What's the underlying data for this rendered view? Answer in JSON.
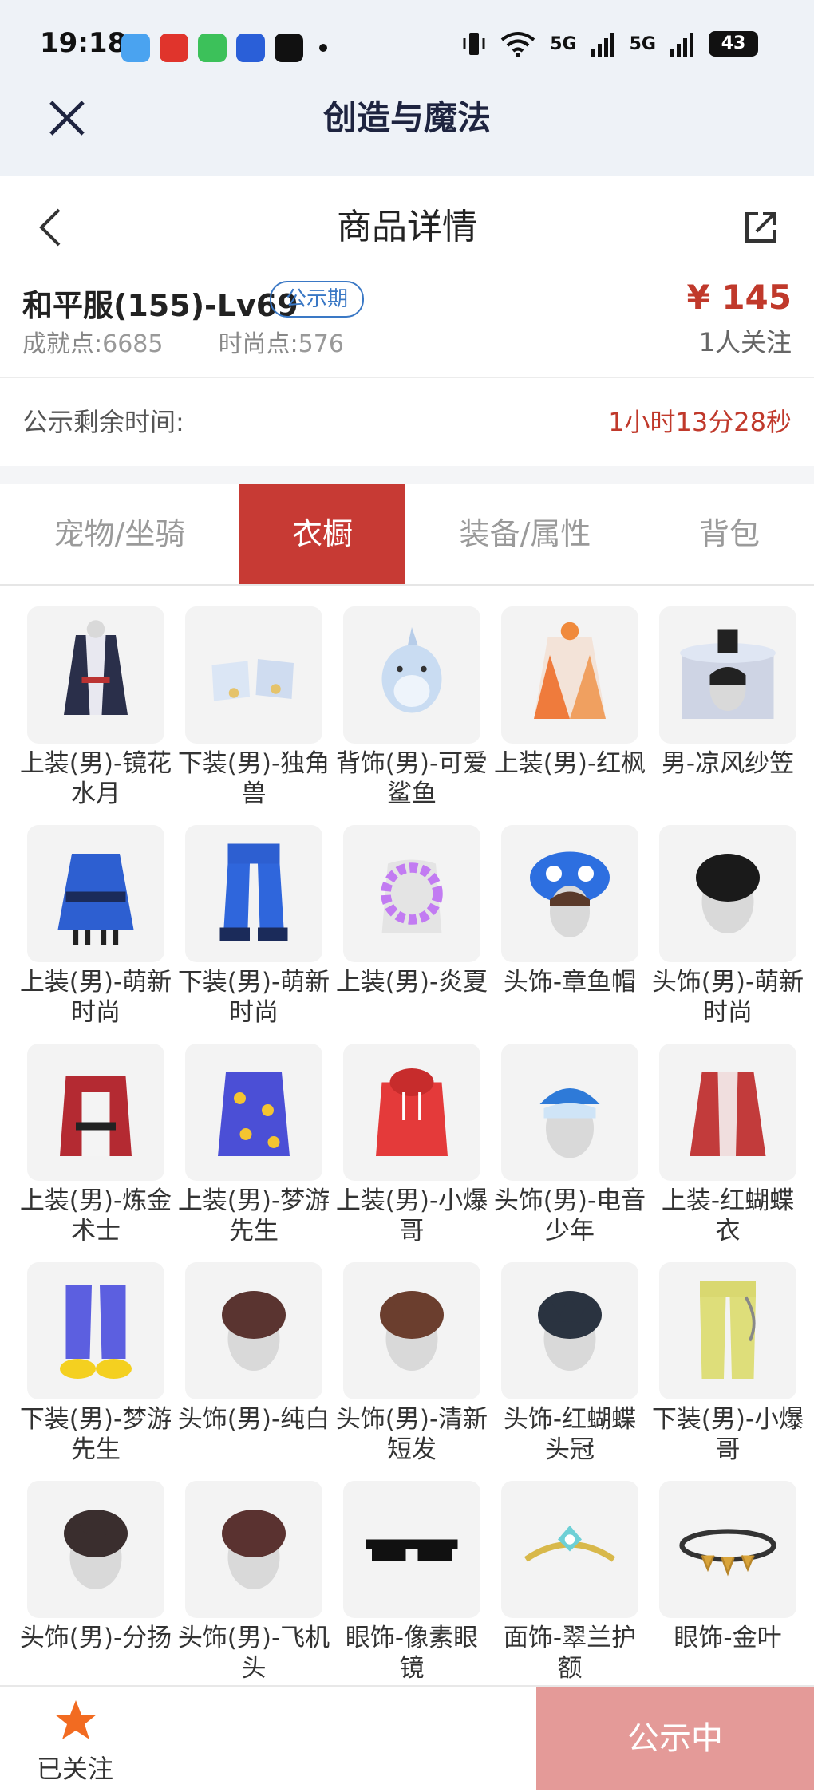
{
  "status_bar": {
    "time": "19:18",
    "network_1": "5G",
    "network_2": "5G",
    "battery": "43",
    "icons": [
      "cloud-app-icon",
      "red-app-icon",
      "message-app-icon",
      "blue-app-icon",
      "capcut-icon",
      "vibrate-icon",
      "wifi-icon",
      "signal-icon"
    ]
  },
  "app_bar": {
    "title": "创造与魔法"
  },
  "header": {
    "title": "商品详情"
  },
  "item": {
    "title": "和平服(155)-Lv69",
    "badge": "公示期",
    "price": "¥ 145",
    "achievement_label": "成就点:",
    "achievement_value": "6685",
    "fashion_label": "时尚点:",
    "fashion_value": "576",
    "followers": "1人关注"
  },
  "remaining": {
    "label": "公示剩余时间:",
    "value": "1小时13分28秒"
  },
  "tabs": [
    {
      "label": "宠物/坐骑",
      "active": false
    },
    {
      "label": "衣橱",
      "active": true
    },
    {
      "label": "装备/属性",
      "active": false
    },
    {
      "label": "背包",
      "active": false
    }
  ],
  "wardrobe": [
    {
      "name": "上装(男)-镜花水月",
      "kind": "robe"
    },
    {
      "name": "下装(男)-独角兽",
      "kind": "boots"
    },
    {
      "name": "背饰(男)-可爱鲨鱼",
      "kind": "shark"
    },
    {
      "name": "上装(男)-红枫",
      "kind": "robe-orange"
    },
    {
      "name": "男-凉风纱笠",
      "kind": "hat"
    },
    {
      "name": "上装(男)-萌新时尚",
      "kind": "robe-blue"
    },
    {
      "name": "下装(男)-萌新时尚",
      "kind": "pants-blue"
    },
    {
      "name": "上装(男)-炎夏",
      "kind": "lei"
    },
    {
      "name": "头饰-章鱼帽",
      "kind": "octopus"
    },
    {
      "name": "头饰(男)-萌新时尚",
      "kind": "hair-black"
    },
    {
      "name": "上装(男)-炼金术士",
      "kind": "robe-red"
    },
    {
      "name": "上装(男)-梦游先生",
      "kind": "pajama"
    },
    {
      "name": "上装(男)-小爆哥",
      "kind": "hoodie"
    },
    {
      "name": "头饰(男)-电音少年",
      "kind": "cap"
    },
    {
      "name": "上装-红蝴蝶衣",
      "kind": "robe-red2"
    },
    {
      "name": "下装(男)-梦游先生",
      "kind": "pajama-pants"
    },
    {
      "name": "头饰(男)-纯白",
      "kind": "hair-brown"
    },
    {
      "name": "头饰(男)-清新短发",
      "kind": "hair-brown2"
    },
    {
      "name": "头饰-红蝴蝶头冠",
      "kind": "hair-dark"
    },
    {
      "name": "下装(男)-小爆哥",
      "kind": "pants-yellow"
    },
    {
      "name": "头饰(男)-分扬",
      "kind": "hair-dark2"
    },
    {
      "name": "头饰(男)-飞机头",
      "kind": "hair-spiky"
    },
    {
      "name": "眼饰-像素眼镜",
      "kind": "glasses"
    },
    {
      "name": "面饰-翠兰护额",
      "kind": "circlet"
    },
    {
      "name": "眼饰-金叶",
      "kind": "band"
    }
  ],
  "bottom": {
    "follow_label": "已关注",
    "action_label": "公示中"
  },
  "colors": {
    "accent_red": "#c73a34",
    "price_red": "#c0392b",
    "badge_blue": "#3a78c5",
    "button_pink": "#e49a98"
  }
}
